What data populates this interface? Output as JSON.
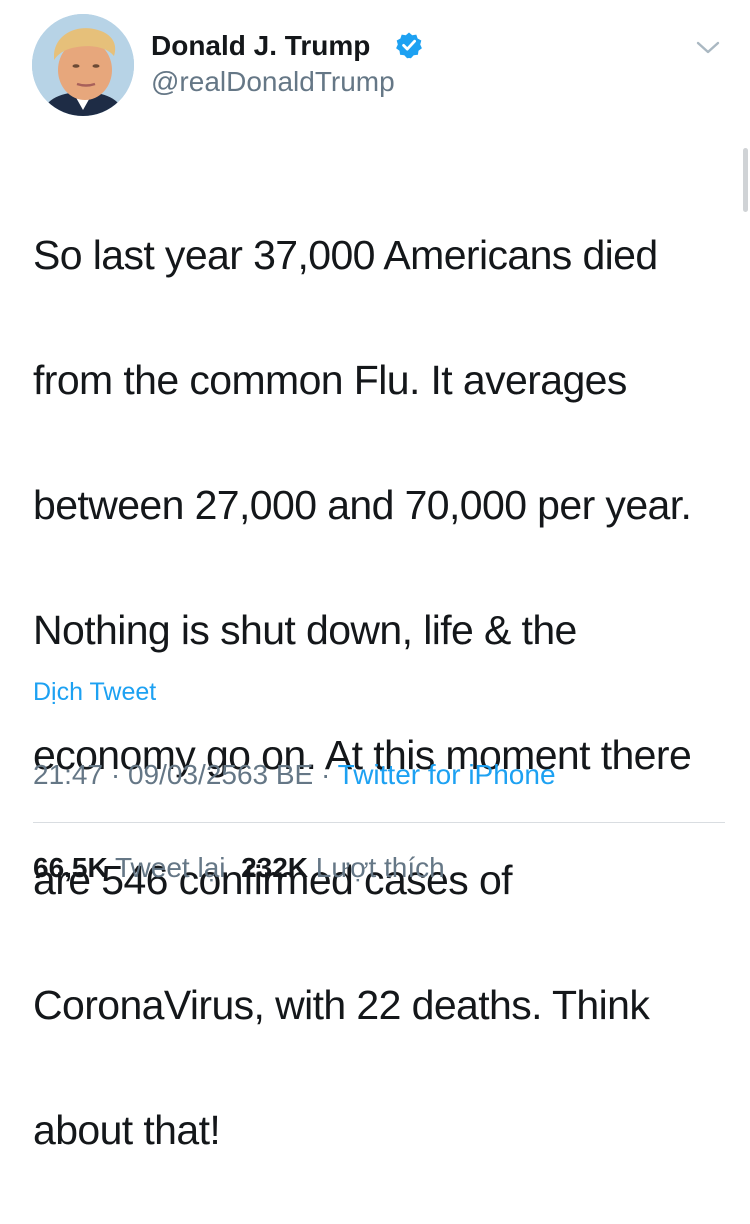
{
  "author": {
    "name": "Donald J. Trump",
    "handle": "@realDonaldTrump",
    "verified_icon": "verified-badge-icon",
    "avatar_icon": "profile-photo"
  },
  "menu_icon": "chevron-down-icon",
  "tweet": {
    "text_lines": [
      "So last year 37,000 Americans died",
      "from the common Flu. It averages",
      "between 27,000 and 70,000 per year.",
      "Nothing is shut down, life & the",
      "economy go on. At this moment there",
      "are 546 confirmed cases of",
      "CoronaVirus, with 22 deaths. Think",
      "about that!"
    ],
    "translate_label": "Dịch Tweet"
  },
  "meta": {
    "time": "21:47",
    "separator": "·",
    "date": "09/03/2563 BE",
    "source": "Twitter for iPhone"
  },
  "stats": {
    "retweets_count": "66,5K",
    "retweets_label": "Tweet lại",
    "likes_count": "232K",
    "likes_label": "Lượt thích"
  },
  "colors": {
    "link": "#1da1f2",
    "secondary_text": "#657786",
    "primary_text": "#14171a",
    "verified": "#1da1f2"
  }
}
